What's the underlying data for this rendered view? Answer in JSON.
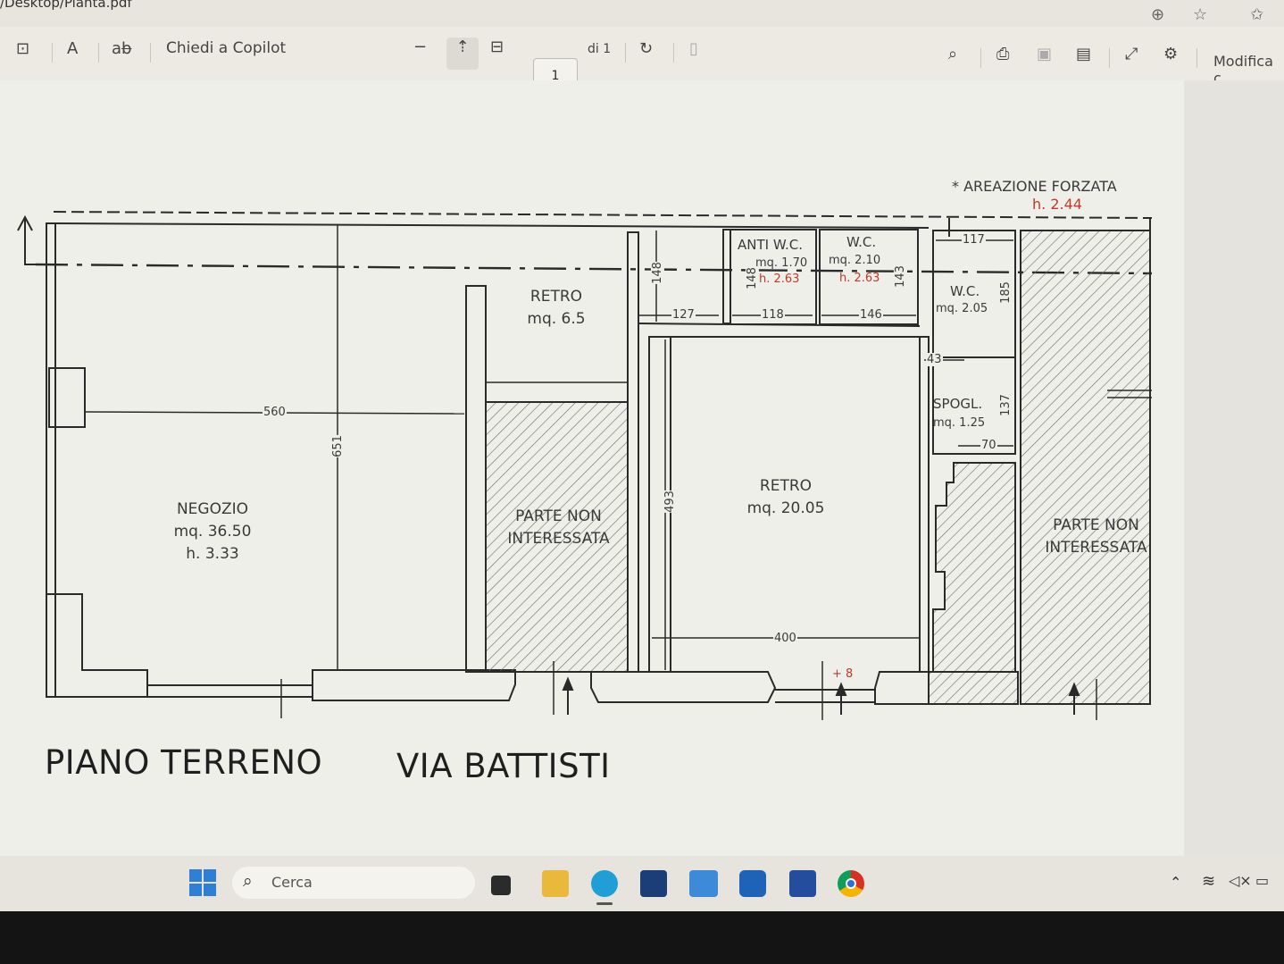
{
  "window": {
    "path": "/Desktop/Pianta.pdf"
  },
  "toolbar": {
    "copilot": "Chiedi a Copilot",
    "page_current": "1",
    "page_total": "di 1",
    "edit": "Modifica c"
  },
  "plan": {
    "areazione": "* AREAZIONE FORZATA",
    "areazione_h": "h. 2.44",
    "negozio": {
      "name": "NEGOZIO",
      "area": "mq. 36.50",
      "height": "h. 3.33"
    },
    "retro_small": {
      "name": "RETRO",
      "area": "mq. 6.5"
    },
    "retro_big": {
      "name": "RETRO",
      "area": "mq. 20.05"
    },
    "anti_wc": {
      "name": "ANTI W.C.",
      "area": "mq. 1.70",
      "height": "h. 2.63"
    },
    "wc1": {
      "name": "W.C.",
      "area": "mq. 2.10",
      "height": "h. 2.63"
    },
    "wc2": {
      "name": "W.C.",
      "area": "mq. 2.05"
    },
    "spogl": {
      "name": "SPOGL.",
      "area": "mq. 1.25"
    },
    "non_int_1": {
      "line1": "PARTE NON",
      "line2": "INTERESSATA"
    },
    "non_int_2": {
      "line1": "PARTE NON",
      "line2": "INTERESSATA"
    },
    "dims": {
      "d560": "560",
      "d651": "651",
      "d493": "493",
      "d400": "400",
      "d148a": "148",
      "d148b": "148",
      "d143": "143",
      "d127": "127",
      "d118": "118",
      "d146": "146",
      "d117": "117",
      "d185": "185",
      "d43": "43",
      "d137": "137",
      "d70": "70",
      "d8": "+ 8"
    },
    "title_left": "PIANO TERRENO",
    "title_right": "VIA BATTISTI"
  },
  "taskbar": {
    "search_placeholder": "Cerca"
  },
  "colors": {
    "ink": "#2a2a2a",
    "paper": "#efefea",
    "red": "#c0392b",
    "hatch": "#6a6a6a"
  }
}
